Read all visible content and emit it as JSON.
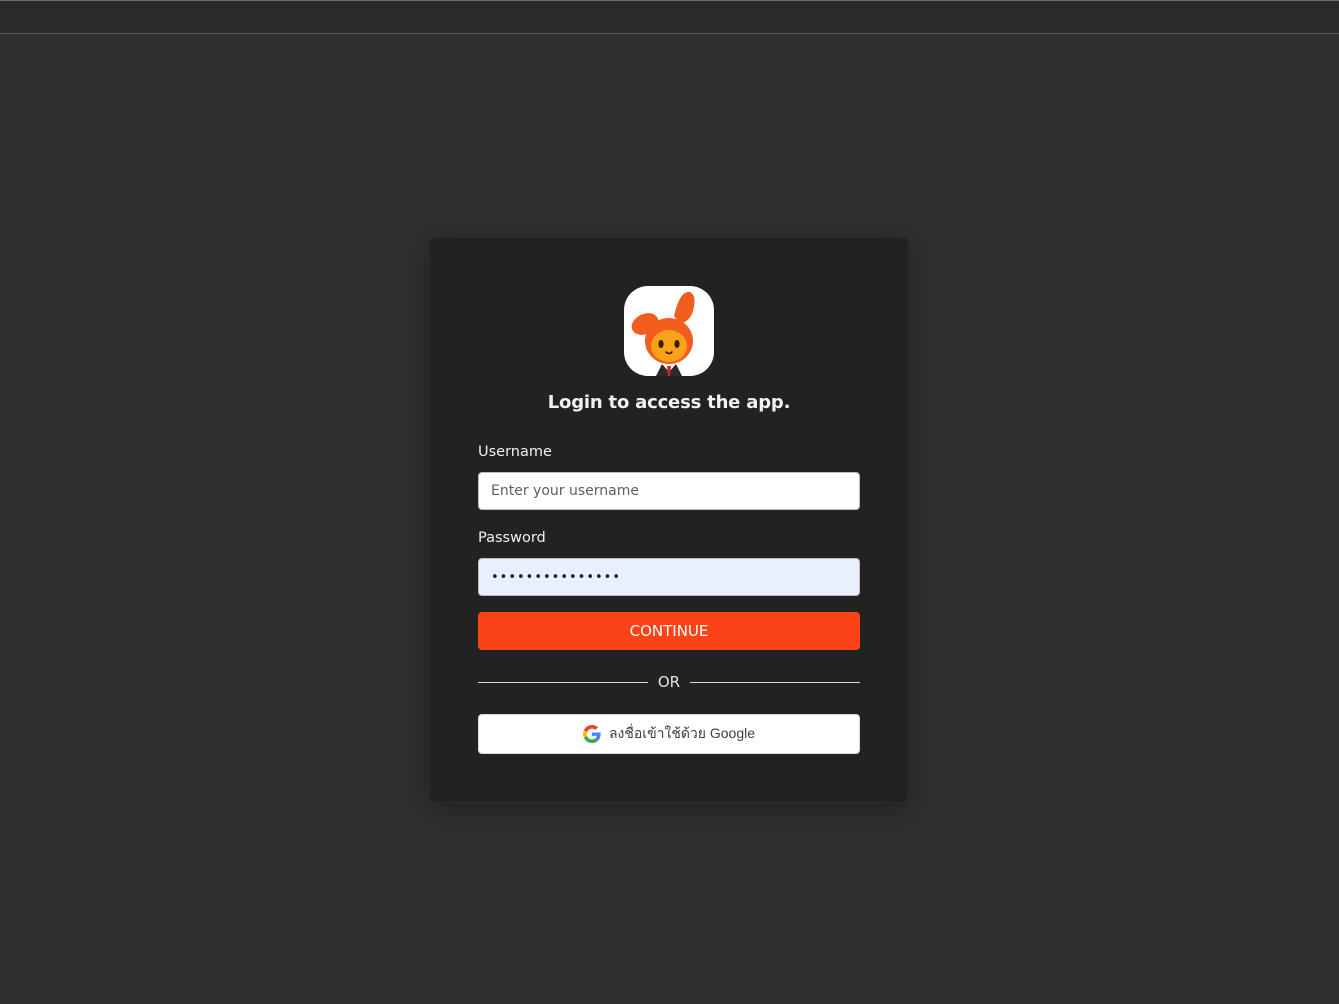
{
  "login": {
    "title": "Login to access the app.",
    "username_label": "Username",
    "username_placeholder": "Enter your username",
    "username_value": "",
    "password_label": "Password",
    "password_value": "•••••••••••••••",
    "continue_label": "CONTINUE",
    "divider_text": "OR",
    "google_label": "ลงชื่อเข้าใช้ด้วย Google"
  },
  "icons": {
    "logo": "orange-rabbit-mascot-logo",
    "google": "google-g-icon"
  },
  "colors": {
    "page_background": "#303030",
    "card_background": "#222222",
    "accent": "#fc4318",
    "autofill_background": "#e8f0fe"
  }
}
